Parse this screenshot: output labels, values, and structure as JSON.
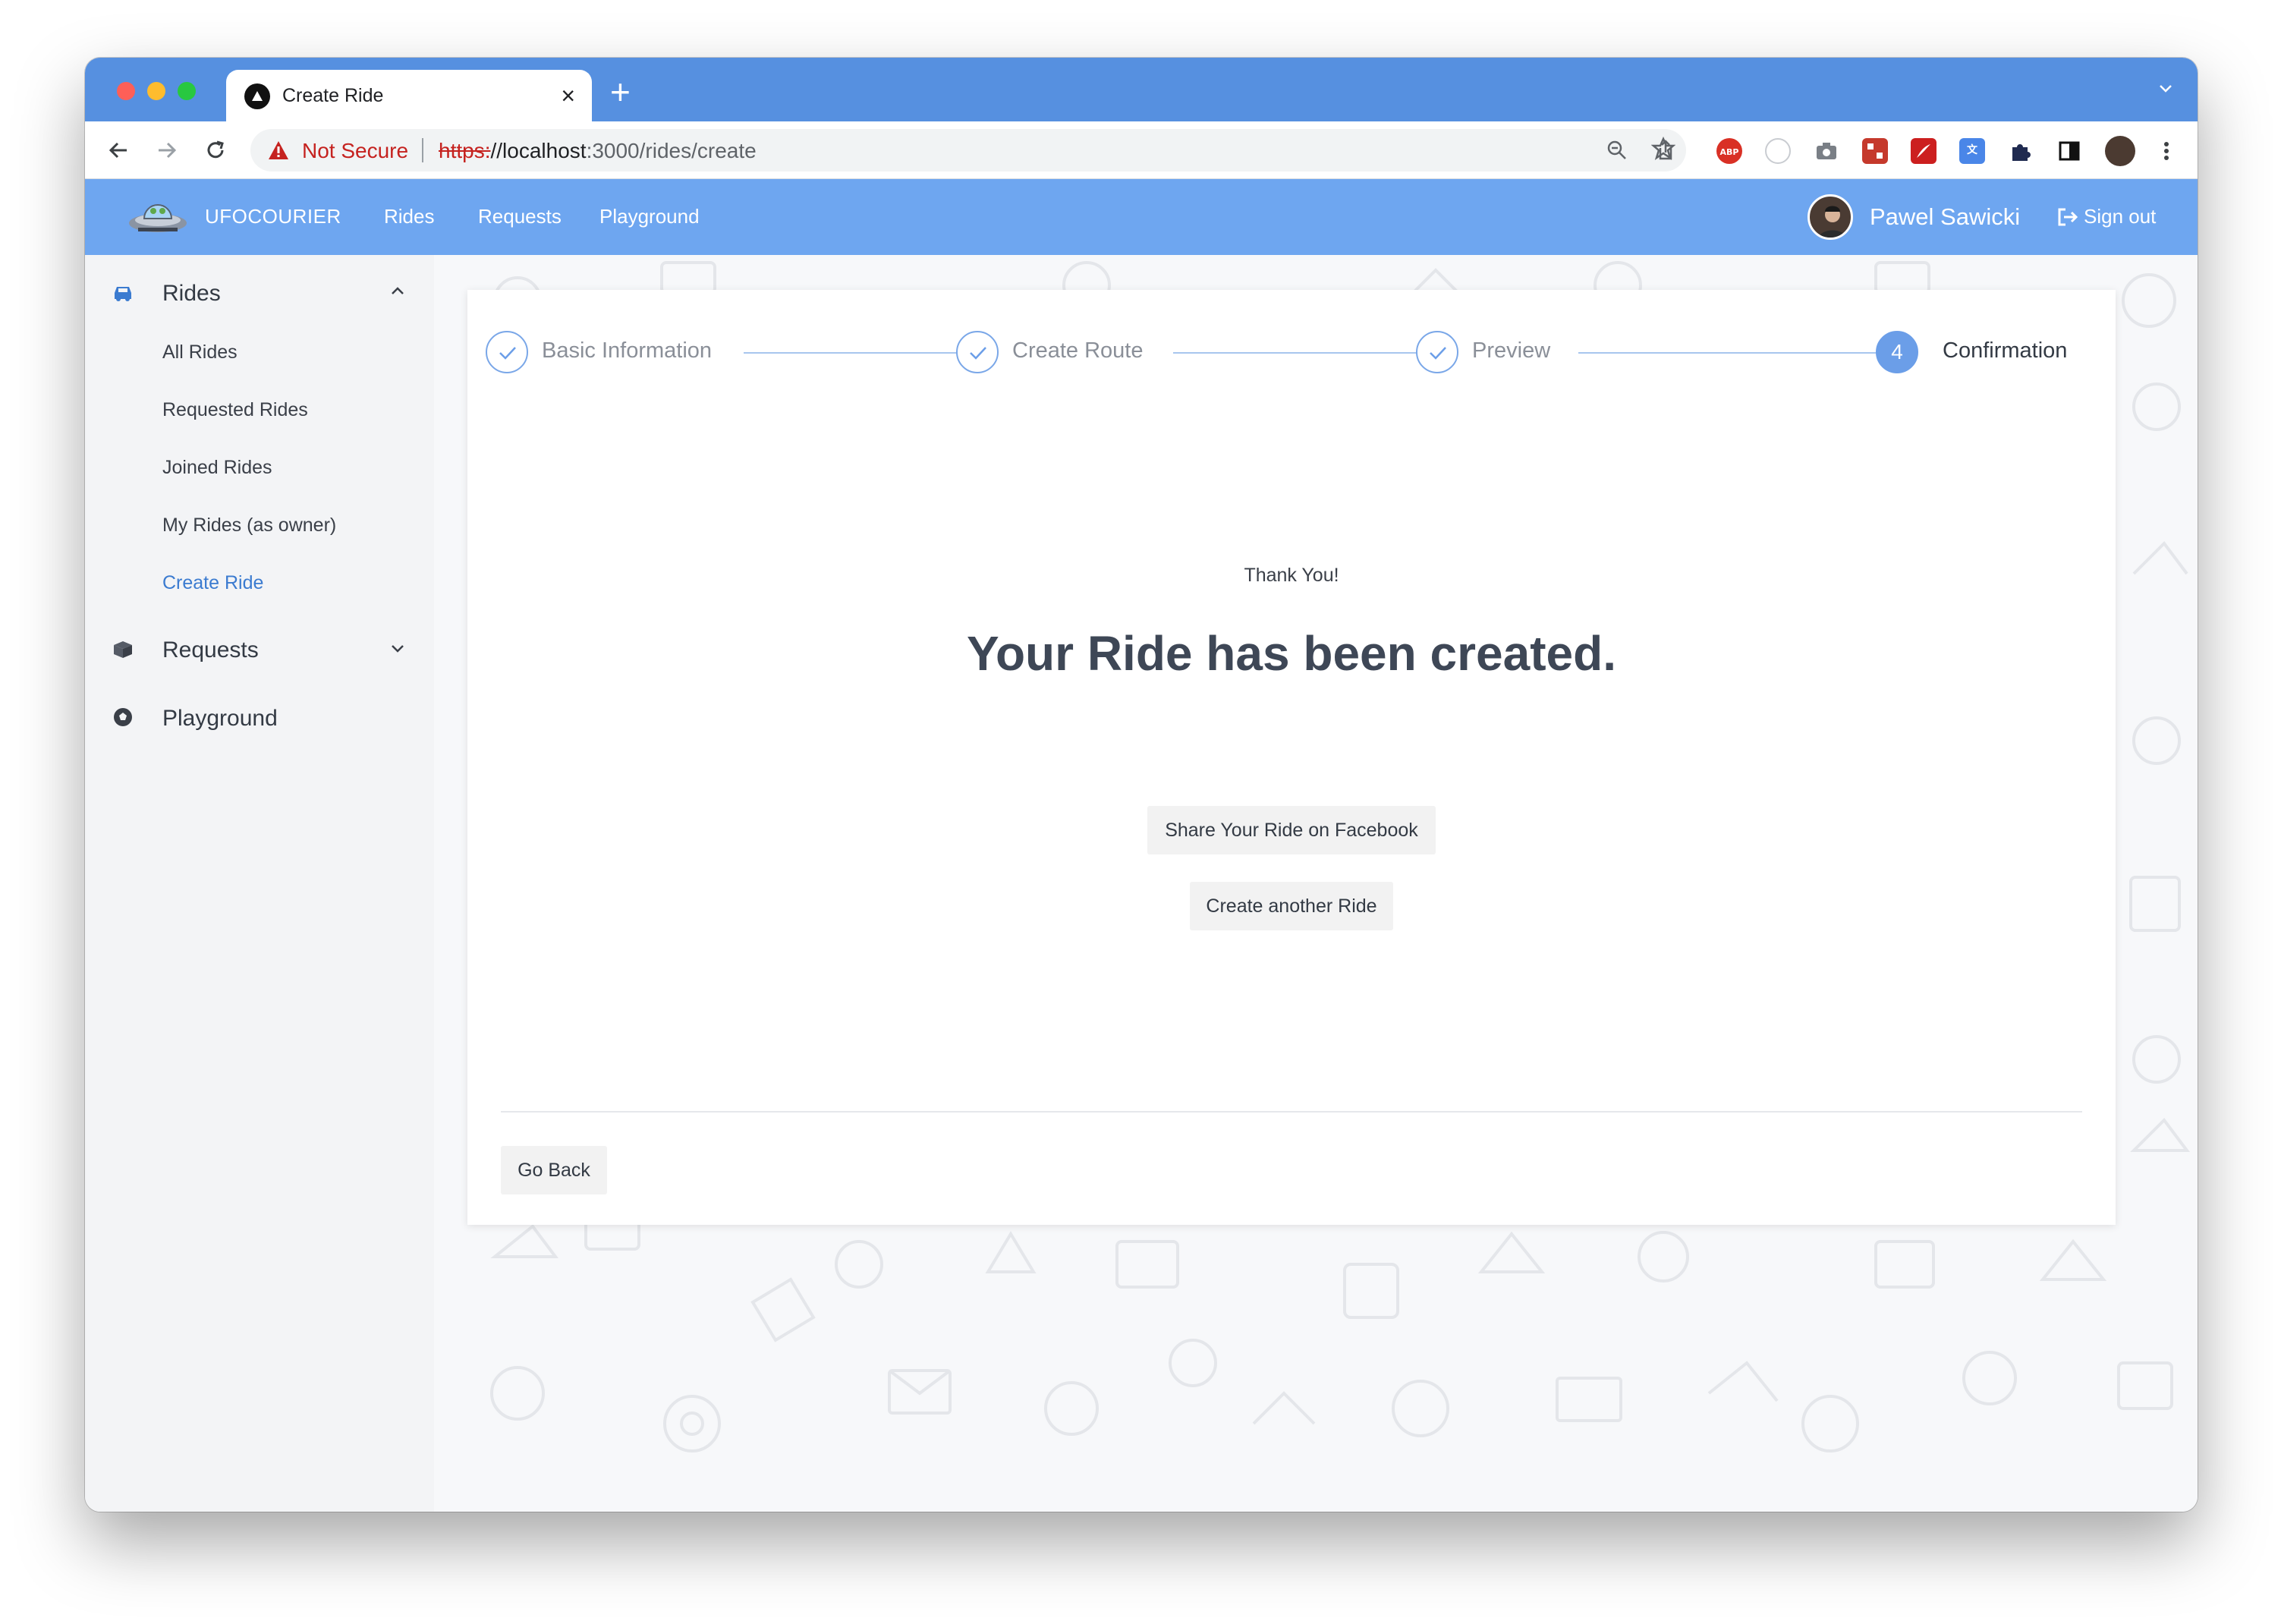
{
  "browser": {
    "tab_title": "Create Ride",
    "not_secure_label": "Not Secure",
    "url_scheme": "https:",
    "url_host": "//localhost",
    "url_path": ":3000/rides/create",
    "extensions": [
      "abp-icon",
      "ghostery-icon",
      "camera-icon",
      "puzzle-game-icon",
      "pdf-icon",
      "translate-icon",
      "extensions-icon",
      "sidepanel-icon",
      "profile-avatar",
      "menu-icon"
    ]
  },
  "app": {
    "brand": "UFOCOURIER",
    "nav": [
      "Rides",
      "Requests",
      "Playground"
    ],
    "user_name": "Pawel Sawicki",
    "sign_out": "Sign out",
    "accent_color": "#6ea6f0"
  },
  "sidebar": {
    "rides": {
      "label": "Rides",
      "items": [
        "All Rides",
        "Requested Rides",
        "Joined Rides",
        "My Rides (as owner)",
        "Create Ride"
      ],
      "active_item": "Create Ride"
    },
    "requests": {
      "label": "Requests"
    },
    "playground": {
      "label": "Playground"
    }
  },
  "wizard": {
    "steps": [
      {
        "label": "Basic Information",
        "state": "done"
      },
      {
        "label": "Create Route",
        "state": "done"
      },
      {
        "label": "Preview",
        "state": "done"
      },
      {
        "label": "Confirmation",
        "state": "active",
        "number": "4"
      }
    ],
    "thanks": "Thank You!",
    "headline": "Your Ride has been created.",
    "share_button": "Share Your Ride on Facebook",
    "create_another_button": "Create another Ride",
    "back_button": "Go Back"
  }
}
